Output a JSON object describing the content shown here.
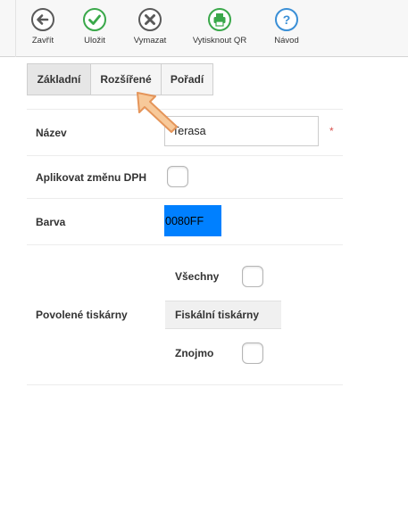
{
  "toolbar": {
    "close_label": "Zavřít",
    "save_label": "Uložit",
    "delete_label": "Vymazat",
    "print_qr_label": "Vytisknout QR",
    "help_label": "Návod",
    "help_glyph": "?"
  },
  "tabs": [
    {
      "label": "Základní",
      "active": true
    },
    {
      "label": "Rozšířené",
      "active": false
    },
    {
      "label": "Pořadí",
      "active": false
    }
  ],
  "form": {
    "name_label": "Název",
    "name_value": "Terasa",
    "required_mark": "*",
    "vat_label": "Aplikovat změnu DPH",
    "vat_checked": false,
    "color_label": "Barva",
    "color_value": "0080FF",
    "printers_label": "Povolené tiskárny",
    "printers": {
      "all_label": "Všechny",
      "all_checked": false,
      "group_label": "Fiskální tiskárny",
      "items": [
        {
          "label": "Znojmo",
          "checked": false
        }
      ]
    }
  },
  "colors": {
    "icon_gray": "#5a5a5a",
    "icon_green": "#3aa84a",
    "icon_blue": "#3a8fd6",
    "swatch": "#0080FF",
    "required": "#d9534f",
    "pointer_fill": "#f7c99a",
    "pointer_stroke": "#e5955a"
  },
  "icons": {
    "close": "arrow-left-circle-icon",
    "save": "check-circle-icon",
    "delete": "x-circle-icon",
    "print_qr": "printer-icon",
    "help": "question-circle-icon",
    "pointer": "arrow-pointer-icon"
  }
}
